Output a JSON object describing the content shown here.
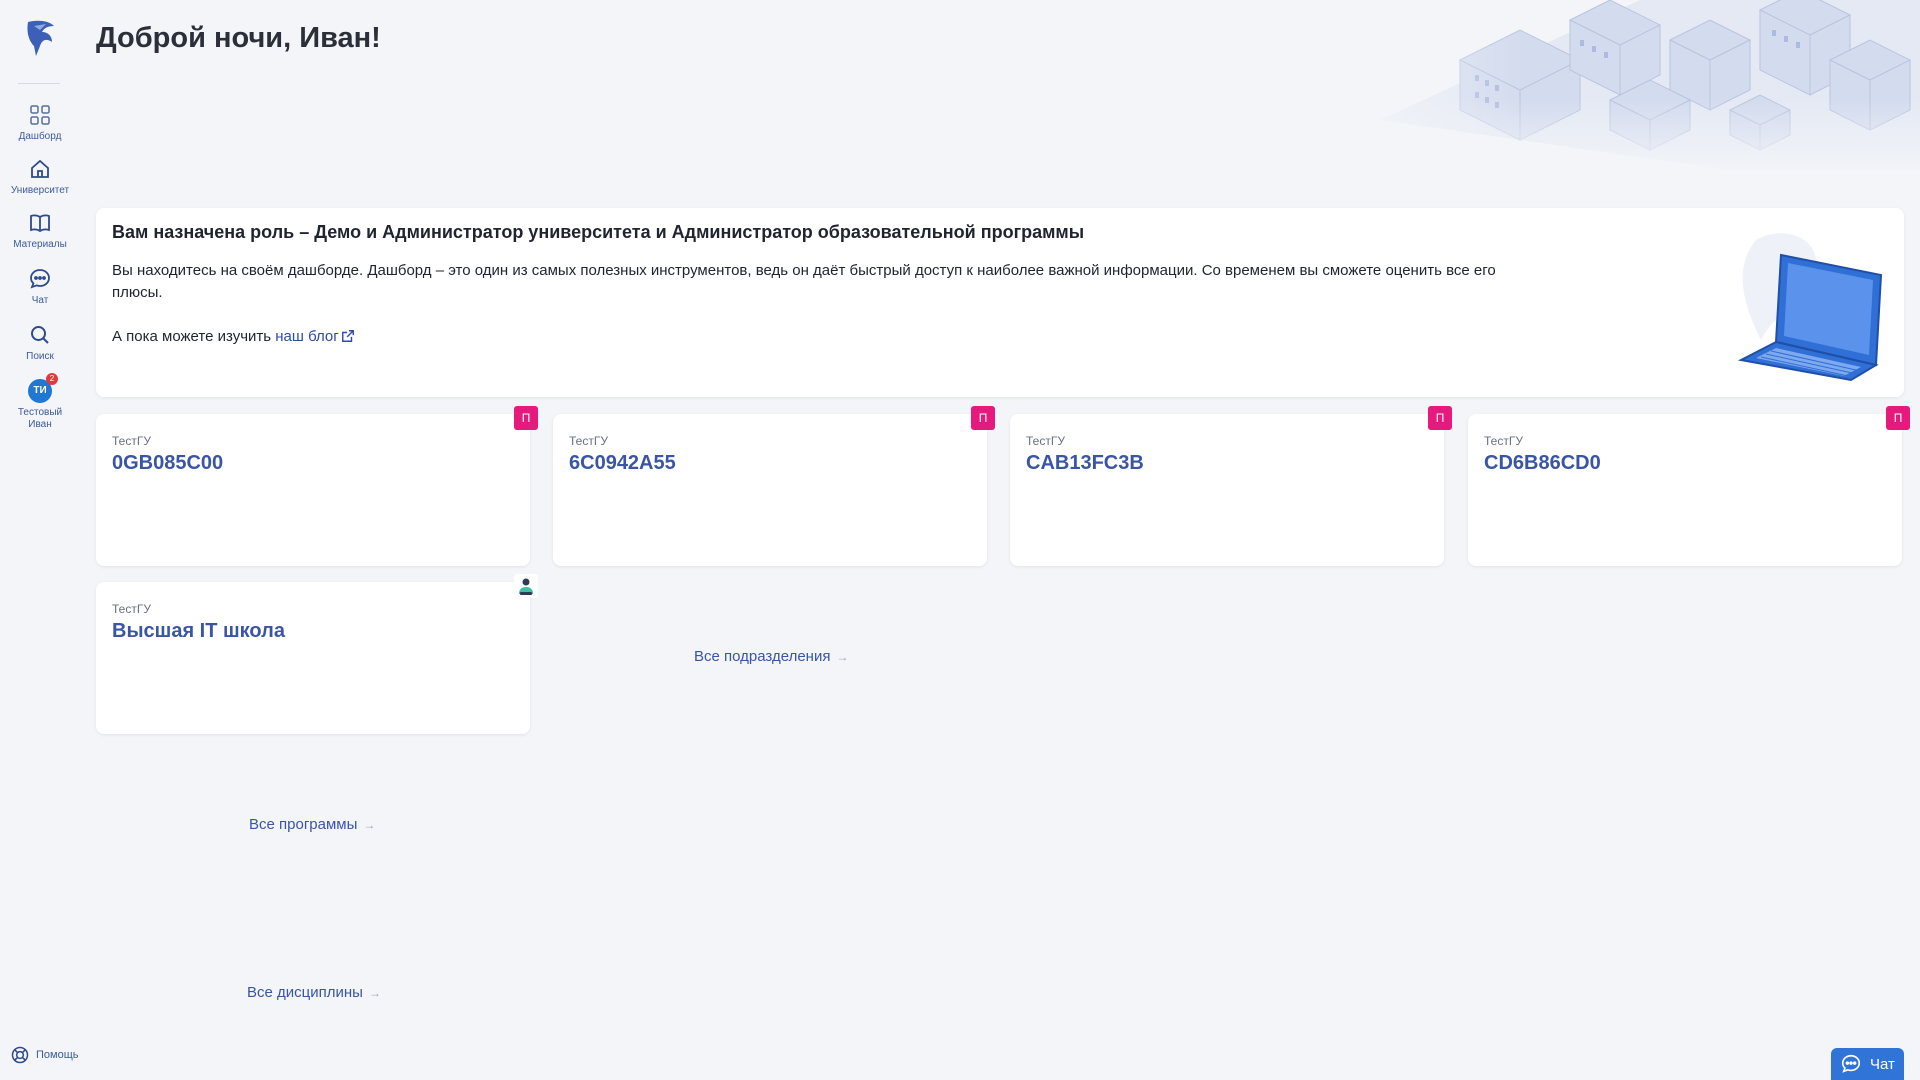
{
  "header": {
    "greeting": "Доброй ночи, Иван!"
  },
  "sidebar": {
    "items": [
      {
        "label": "Дашборд",
        "icon": "grid-icon"
      },
      {
        "label": "Университет",
        "icon": "home-icon"
      },
      {
        "label": "Материалы",
        "icon": "book-icon"
      },
      {
        "label": "Чат",
        "icon": "chat-icon"
      },
      {
        "label": "Поиск",
        "icon": "search-icon"
      }
    ],
    "user": {
      "initials": "ТИ",
      "badge": "2",
      "name": "Тестовый Иван"
    },
    "help_label": "Помощь"
  },
  "role_card": {
    "title": "Вам назначена роль – Демо и Администратор университета и Администратор образовательной программы",
    "text": "Вы находитесь на своём дашборде. Дашборд – это один из самых полезных инструментов, ведь он даёт быстрый доступ к наиболее важной информации. Со временем вы сможете оценить все его плюсы.",
    "more_prefix": "А пока можете изучить",
    "blog_link": "наш блог"
  },
  "divisions": [
    {
      "university": "ТестГУ",
      "code": "0GB085C00",
      "tag": "П"
    },
    {
      "university": "ТестГУ",
      "code": "6C0942A55",
      "tag": "П"
    },
    {
      "university": "ТестГУ",
      "code": "CAB13FC3B",
      "tag": "П"
    },
    {
      "university": "ТестГУ",
      "code": "CD6B86CD0",
      "tag": "П"
    },
    {
      "university": "ТестГУ",
      "code": "Высшая IT школа",
      "tag": ""
    }
  ],
  "links": {
    "all_divisions": "Все подразделения",
    "all_programs": "Все программы",
    "all_disciplines": "Все дисциплины"
  },
  "chat_button": {
    "label": "Чат"
  },
  "colors": {
    "accent": "#3a55a5",
    "tag": "#e6197d",
    "chat": "#2f74d6",
    "badge": "#e5383b"
  }
}
